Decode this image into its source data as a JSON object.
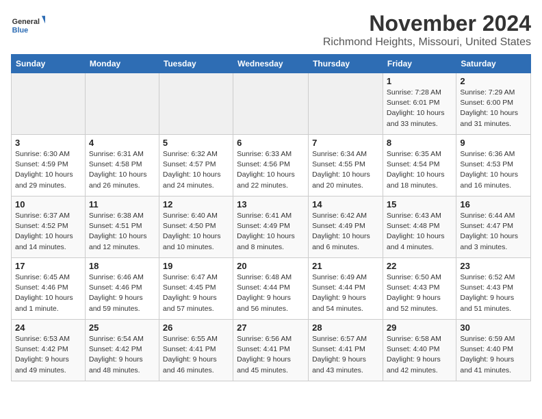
{
  "logo": {
    "general": "General",
    "blue": "Blue"
  },
  "title": "November 2024",
  "location": "Richmond Heights, Missouri, United States",
  "days_header": [
    "Sunday",
    "Monday",
    "Tuesday",
    "Wednesday",
    "Thursday",
    "Friday",
    "Saturday"
  ],
  "weeks": [
    [
      {
        "day": "",
        "info": ""
      },
      {
        "day": "",
        "info": ""
      },
      {
        "day": "",
        "info": ""
      },
      {
        "day": "",
        "info": ""
      },
      {
        "day": "",
        "info": ""
      },
      {
        "day": "1",
        "info": "Sunrise: 7:28 AM\nSunset: 6:01 PM\nDaylight: 10 hours and 33 minutes."
      },
      {
        "day": "2",
        "info": "Sunrise: 7:29 AM\nSunset: 6:00 PM\nDaylight: 10 hours and 31 minutes."
      }
    ],
    [
      {
        "day": "3",
        "info": "Sunrise: 6:30 AM\nSunset: 4:59 PM\nDaylight: 10 hours and 29 minutes."
      },
      {
        "day": "4",
        "info": "Sunrise: 6:31 AM\nSunset: 4:58 PM\nDaylight: 10 hours and 26 minutes."
      },
      {
        "day": "5",
        "info": "Sunrise: 6:32 AM\nSunset: 4:57 PM\nDaylight: 10 hours and 24 minutes."
      },
      {
        "day": "6",
        "info": "Sunrise: 6:33 AM\nSunset: 4:56 PM\nDaylight: 10 hours and 22 minutes."
      },
      {
        "day": "7",
        "info": "Sunrise: 6:34 AM\nSunset: 4:55 PM\nDaylight: 10 hours and 20 minutes."
      },
      {
        "day": "8",
        "info": "Sunrise: 6:35 AM\nSunset: 4:54 PM\nDaylight: 10 hours and 18 minutes."
      },
      {
        "day": "9",
        "info": "Sunrise: 6:36 AM\nSunset: 4:53 PM\nDaylight: 10 hours and 16 minutes."
      }
    ],
    [
      {
        "day": "10",
        "info": "Sunrise: 6:37 AM\nSunset: 4:52 PM\nDaylight: 10 hours and 14 minutes."
      },
      {
        "day": "11",
        "info": "Sunrise: 6:38 AM\nSunset: 4:51 PM\nDaylight: 10 hours and 12 minutes."
      },
      {
        "day": "12",
        "info": "Sunrise: 6:40 AM\nSunset: 4:50 PM\nDaylight: 10 hours and 10 minutes."
      },
      {
        "day": "13",
        "info": "Sunrise: 6:41 AM\nSunset: 4:49 PM\nDaylight: 10 hours and 8 minutes."
      },
      {
        "day": "14",
        "info": "Sunrise: 6:42 AM\nSunset: 4:49 PM\nDaylight: 10 hours and 6 minutes."
      },
      {
        "day": "15",
        "info": "Sunrise: 6:43 AM\nSunset: 4:48 PM\nDaylight: 10 hours and 4 minutes."
      },
      {
        "day": "16",
        "info": "Sunrise: 6:44 AM\nSunset: 4:47 PM\nDaylight: 10 hours and 3 minutes."
      }
    ],
    [
      {
        "day": "17",
        "info": "Sunrise: 6:45 AM\nSunset: 4:46 PM\nDaylight: 10 hours and 1 minute."
      },
      {
        "day": "18",
        "info": "Sunrise: 6:46 AM\nSunset: 4:46 PM\nDaylight: 9 hours and 59 minutes."
      },
      {
        "day": "19",
        "info": "Sunrise: 6:47 AM\nSunset: 4:45 PM\nDaylight: 9 hours and 57 minutes."
      },
      {
        "day": "20",
        "info": "Sunrise: 6:48 AM\nSunset: 4:44 PM\nDaylight: 9 hours and 56 minutes."
      },
      {
        "day": "21",
        "info": "Sunrise: 6:49 AM\nSunset: 4:44 PM\nDaylight: 9 hours and 54 minutes."
      },
      {
        "day": "22",
        "info": "Sunrise: 6:50 AM\nSunset: 4:43 PM\nDaylight: 9 hours and 52 minutes."
      },
      {
        "day": "23",
        "info": "Sunrise: 6:52 AM\nSunset: 4:43 PM\nDaylight: 9 hours and 51 minutes."
      }
    ],
    [
      {
        "day": "24",
        "info": "Sunrise: 6:53 AM\nSunset: 4:42 PM\nDaylight: 9 hours and 49 minutes."
      },
      {
        "day": "25",
        "info": "Sunrise: 6:54 AM\nSunset: 4:42 PM\nDaylight: 9 hours and 48 minutes."
      },
      {
        "day": "26",
        "info": "Sunrise: 6:55 AM\nSunset: 4:41 PM\nDaylight: 9 hours and 46 minutes."
      },
      {
        "day": "27",
        "info": "Sunrise: 6:56 AM\nSunset: 4:41 PM\nDaylight: 9 hours and 45 minutes."
      },
      {
        "day": "28",
        "info": "Sunrise: 6:57 AM\nSunset: 4:41 PM\nDaylight: 9 hours and 43 minutes."
      },
      {
        "day": "29",
        "info": "Sunrise: 6:58 AM\nSunset: 4:40 PM\nDaylight: 9 hours and 42 minutes."
      },
      {
        "day": "30",
        "info": "Sunrise: 6:59 AM\nSunset: 4:40 PM\nDaylight: 9 hours and 41 minutes."
      }
    ]
  ]
}
